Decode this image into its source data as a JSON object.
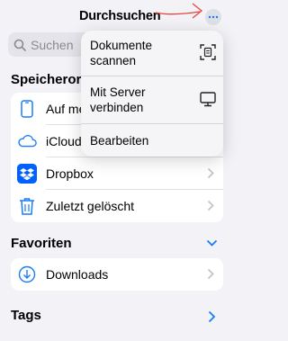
{
  "header": {
    "title": "Durchsuchen"
  },
  "search": {
    "placeholder": "Suchen"
  },
  "sections": {
    "locations": "Speicherorte",
    "favorites": "Favoriten",
    "tags": "Tags"
  },
  "locations": [
    {
      "label": "Auf meinem iPhone",
      "icon": "iphone-icon"
    },
    {
      "label": "iCloud Drive",
      "icon": "icloud-icon"
    },
    {
      "label": "Dropbox",
      "icon": "dropbox-icon"
    },
    {
      "label": "Zuletzt gelöscht",
      "icon": "trash-icon"
    }
  ],
  "favorites": [
    {
      "label": "Downloads",
      "icon": "download-circle-icon"
    }
  ],
  "menu": {
    "items": [
      {
        "label": "Dokumente scannen",
        "icon": "document-scan-icon"
      },
      {
        "label": "Mit Server verbinden",
        "icon": "monitor-icon"
      },
      {
        "label": "Bearbeiten"
      }
    ]
  },
  "colors": {
    "accent": "#1a7cf5",
    "arrow": "#e8453c",
    "dropbox": "#0061fe"
  }
}
